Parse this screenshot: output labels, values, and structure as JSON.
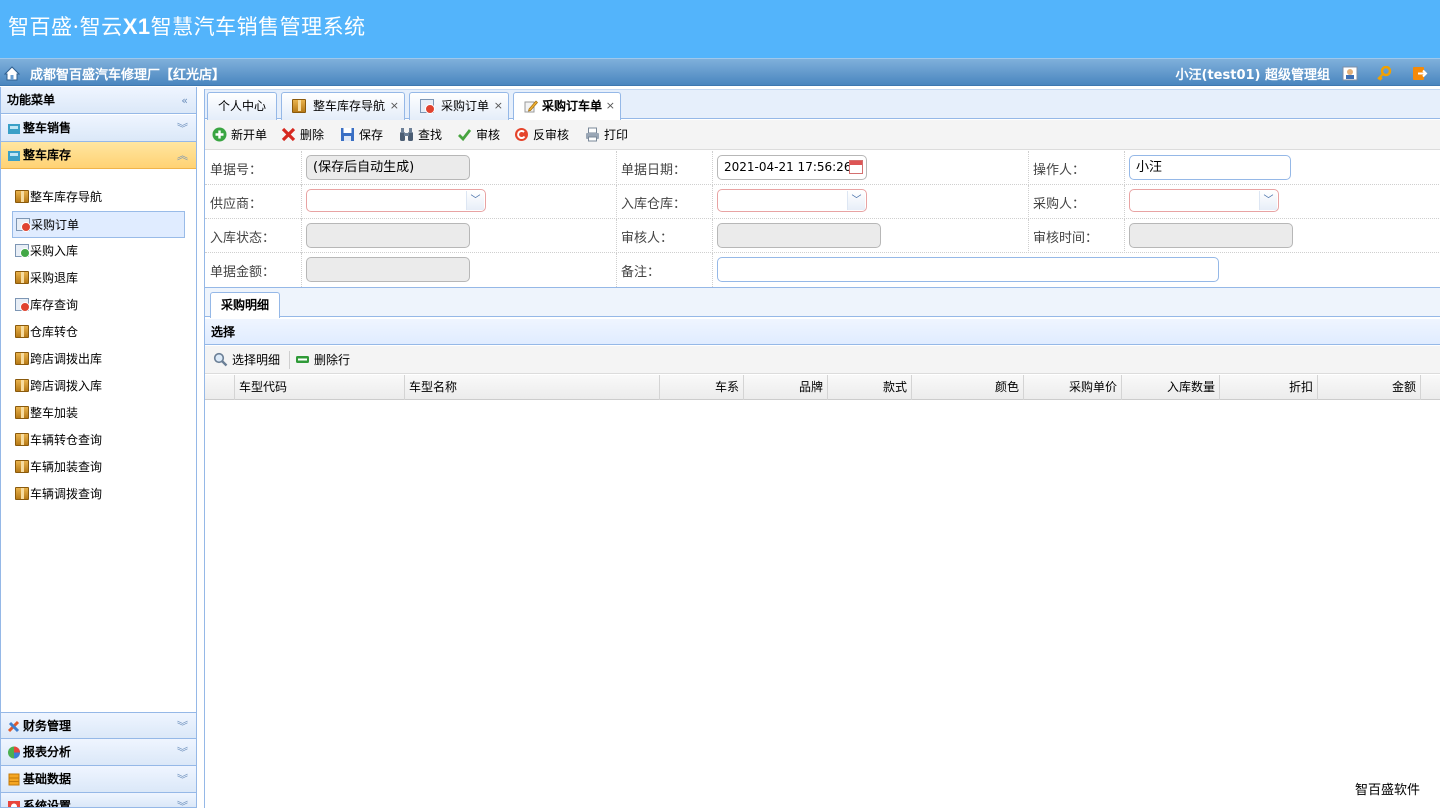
{
  "header": {
    "title_prefix": "智百盛·智云",
    "title_bold": "X1",
    "title_suffix": "智慧汽车销售管理系统",
    "shop_name": "成都智百盛汽车修理厂【红光店】",
    "user": "小汪(test01)  超级管理组",
    "icons": [
      "home-icon",
      "user-card-icon",
      "key-icon",
      "logout-icon"
    ]
  },
  "sidebar": {
    "title": "功能菜单",
    "groups_top": [
      {
        "label": "整车销售",
        "icon": "car-sales-icon"
      },
      {
        "label": "整车库存",
        "icon": "car-stock-icon",
        "active": true
      }
    ],
    "items": [
      {
        "label": "整车库存导航",
        "icon": "box-icon"
      },
      {
        "label": "采购订单",
        "icon": "order-icon",
        "selected": true
      },
      {
        "label": "采购入库",
        "icon": "stock-in-icon"
      },
      {
        "label": "采购退库",
        "icon": "box-icon"
      },
      {
        "label": "库存查询",
        "icon": "order-icon"
      },
      {
        "label": "仓库转仓",
        "icon": "box-icon"
      },
      {
        "label": "跨店调拨出库",
        "icon": "box-icon"
      },
      {
        "label": "跨店调拨入库",
        "icon": "box-icon"
      },
      {
        "label": "整车加装",
        "icon": "box-icon"
      },
      {
        "label": "车辆转仓查询",
        "icon": "box-icon"
      },
      {
        "label": "车辆加装查询",
        "icon": "box-icon"
      },
      {
        "label": "车辆调拨查询",
        "icon": "box-icon"
      }
    ],
    "groups_bottom": [
      {
        "label": "财务管理",
        "icon": "finance-icon"
      },
      {
        "label": "报表分析",
        "icon": "report-icon"
      },
      {
        "label": "基础数据",
        "icon": "database-icon"
      },
      {
        "label": "系统设置",
        "icon": "settings-icon"
      }
    ]
  },
  "tabs": [
    {
      "label": "个人中心",
      "closable": false
    },
    {
      "label": "整车库存导航",
      "closable": true
    },
    {
      "label": "采购订单",
      "closable": true
    },
    {
      "label": "采购订车单",
      "closable": true,
      "active": true
    }
  ],
  "toolbar": {
    "new": "新开单",
    "delete": "删除",
    "save": "保存",
    "find": "查找",
    "audit": "审核",
    "unaudit": "反审核",
    "print": "打印"
  },
  "form": {
    "doc_no_label": "单据号：",
    "doc_no_value": "(保存后自动生成)",
    "doc_date_label": "单据日期：",
    "doc_date_value": "2021-04-21 17:56:26",
    "operator_label": "操作人：",
    "operator_value": "小汪",
    "supplier_label": "供应商：",
    "warehouse_label": "入库仓库：",
    "buyer_label": "采购人：",
    "status_label": "入库状态：",
    "auditor_label": "审核人：",
    "audit_time_label": "审核时间：",
    "amount_label": "单据金额：",
    "remark_label": "备注："
  },
  "detail": {
    "tab": "采购明细",
    "panel_title": "选择",
    "select_detail": "选择明细",
    "delete_row": "删除行",
    "columns": [
      "车型代码",
      "车型名称",
      "车系",
      "品牌",
      "款式",
      "颜色",
      "采购单价",
      "入库数量",
      "折扣",
      "金额"
    ]
  },
  "footer": {
    "brand": "智百盛软件"
  }
}
